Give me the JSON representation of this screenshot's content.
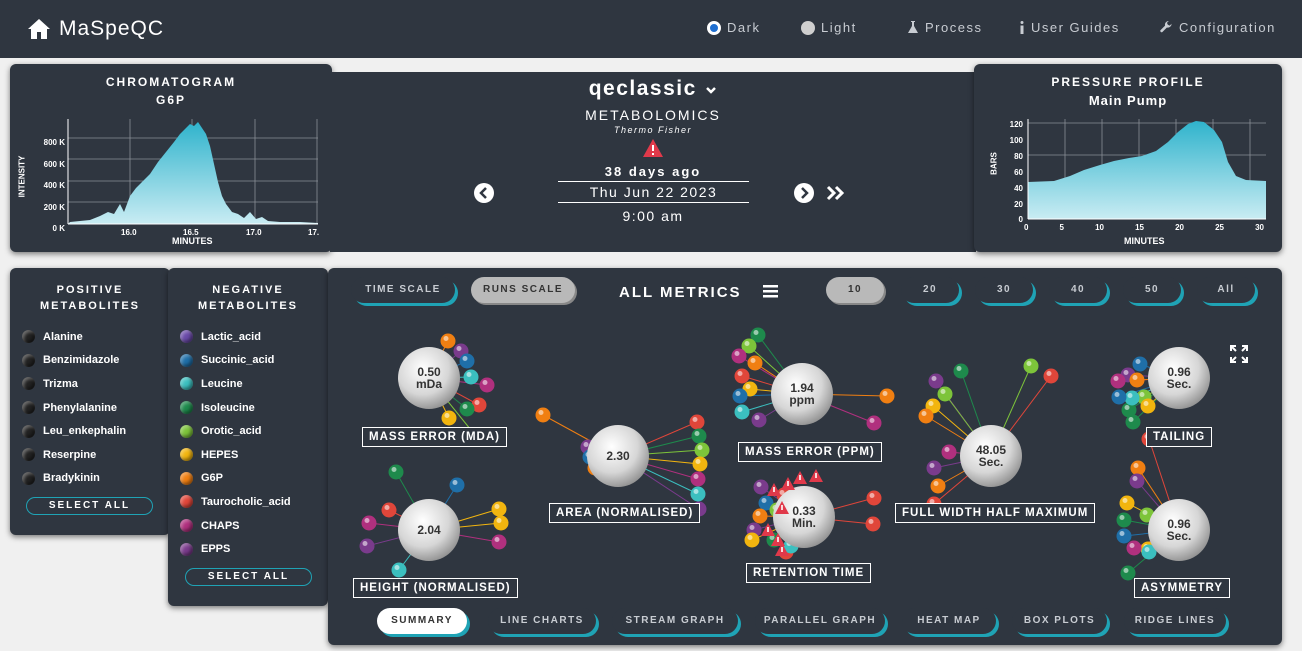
{
  "app": {
    "title": "MaSpeQC"
  },
  "nav": {
    "dark": "Dark",
    "light": "Light",
    "process": "Process",
    "guides": "User Guides",
    "config": "Configuration"
  },
  "chromatogram": {
    "title": "CHROMATOGRAM",
    "subtitle": "G6P",
    "ylabel": "INTENSITY",
    "xlabel": "MINUTES",
    "yticks": [
      "800 K",
      "600 K",
      "400 K",
      "200 K",
      "0 K"
    ],
    "xticks": [
      "16.0",
      "16.5",
      "17.0",
      "17."
    ]
  },
  "pressure": {
    "title": "PRESSURE PROFILE",
    "subtitle": "Main Pump",
    "ylabel": "BARS",
    "xlabel": "MINUTES",
    "yticks": [
      "120",
      "100",
      "80",
      "60",
      "40",
      "20",
      "0"
    ],
    "xticks": [
      "0",
      "5",
      "10",
      "15",
      "20",
      "25",
      "30"
    ]
  },
  "instrument": {
    "name": "qeclassic",
    "type": "METABOLOMICS",
    "vendor": "Thermo Fisher",
    "ago": "38 days ago",
    "date": "Thu Jun 22 2023",
    "time": "9:00 am"
  },
  "positive": {
    "title1": "POSITIVE",
    "title2": "METABOLITES",
    "items": [
      "Alanine",
      "Benzimidazole",
      "Trizma",
      "Phenylalanine",
      "Leu_enkephalin",
      "Reserpine",
      "Bradykinin"
    ],
    "select_all": "SELECT ALL"
  },
  "negative": {
    "title1": "NEGATIVE",
    "title2": "METABOLITES",
    "items": [
      {
        "name": "Lactic_acid",
        "color": "#6a4aa8"
      },
      {
        "name": "Succinic_acid",
        "color": "#1f6fa8"
      },
      {
        "name": "Leucine",
        "color": "#3bbfbf"
      },
      {
        "name": "Isoleucine",
        "color": "#1e8a4c"
      },
      {
        "name": "Orotic_acid",
        "color": "#7dc43a"
      },
      {
        "name": "HEPES",
        "color": "#f2b50f"
      },
      {
        "name": "G6P",
        "color": "#f07f12"
      },
      {
        "name": "Taurocholic_acid",
        "color": "#e0463a"
      },
      {
        "name": "CHAPS",
        "color": "#b0307e"
      },
      {
        "name": "EPPS",
        "color": "#7a3b8c"
      }
    ],
    "select_all": "SELECT ALL"
  },
  "metrics": {
    "time_scale": "TIME SCALE",
    "runs_scale": "RUNS SCALE",
    "title": "ALL METRICS",
    "ranges": [
      "10",
      "20",
      "30",
      "40",
      "50",
      "All"
    ],
    "bubbles": [
      {
        "value": "0.50",
        "unit": "mDa",
        "label": "MASS ERROR (MDA)"
      },
      {
        "value": "2.04",
        "unit": "",
        "label": "HEIGHT (NORMALISED)"
      },
      {
        "value": "2.30",
        "unit": "",
        "label": "AREA (NORMALISED)"
      },
      {
        "value": "1.94",
        "unit": "ppm",
        "label": "MASS ERROR (PPM)"
      },
      {
        "value": "0.33",
        "unit": "Min.",
        "label": "RETENTION TIME"
      },
      {
        "value": "48.05",
        "unit": "Sec.",
        "label": "FULL WIDTH HALF MAXIMUM"
      },
      {
        "value": "0.96",
        "unit": "Sec.",
        "label": "TAILING"
      },
      {
        "value": "0.96",
        "unit": "Sec.",
        "label": "ASYMMETRY"
      }
    ]
  },
  "views": [
    "SUMMARY",
    "LINE CHARTS",
    "STREAM GRAPH",
    "PARALLEL GRAPH",
    "HEAT MAP",
    "BOX PLOTS",
    "RIDGE LINES"
  ]
}
